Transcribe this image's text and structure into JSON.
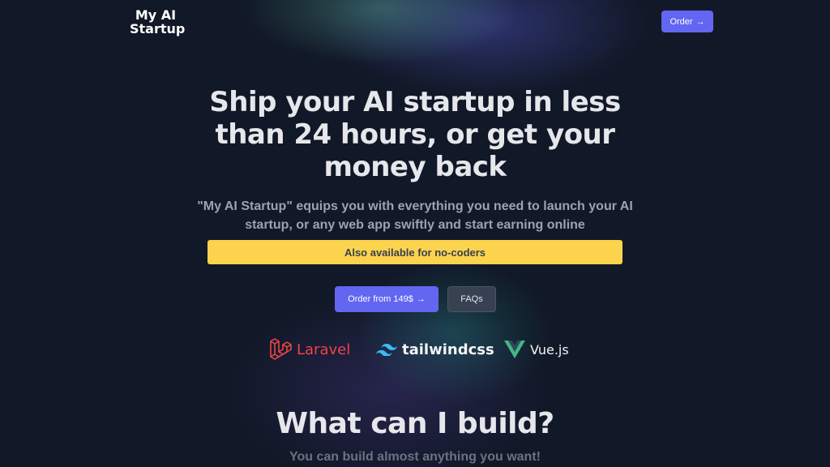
{
  "brand": {
    "line1": "My AI",
    "line2": "Startup"
  },
  "nav": {
    "order_label": "Order",
    "order_icon": "arrow-right-icon"
  },
  "hero": {
    "title": "Ship your AI startup in less than 24 hours, or get your money back",
    "subtitle": "\"My AI Startup\" equips you with everything you need to launch your AI startup, or any web app swiftly and start earning online",
    "banner": "Also available for no-coders",
    "primary_cta": "Order from 149$",
    "secondary_cta": "FAQs"
  },
  "tech_stack": [
    {
      "name": "Laravel",
      "icon": "laravel-icon",
      "color": "#ef4444"
    },
    {
      "name": "tailwindcss",
      "icon": "tailwind-icon",
      "color": "#38bdf8"
    },
    {
      "name": "Vue.js",
      "icon": "vue-icon",
      "color": "#42b883"
    }
  ],
  "section": {
    "title": "What can I build?",
    "subtitle": "You can build almost anything you want!"
  },
  "colors": {
    "background": "#111827",
    "accent": "#6366f1",
    "banner": "#fcd34d"
  }
}
